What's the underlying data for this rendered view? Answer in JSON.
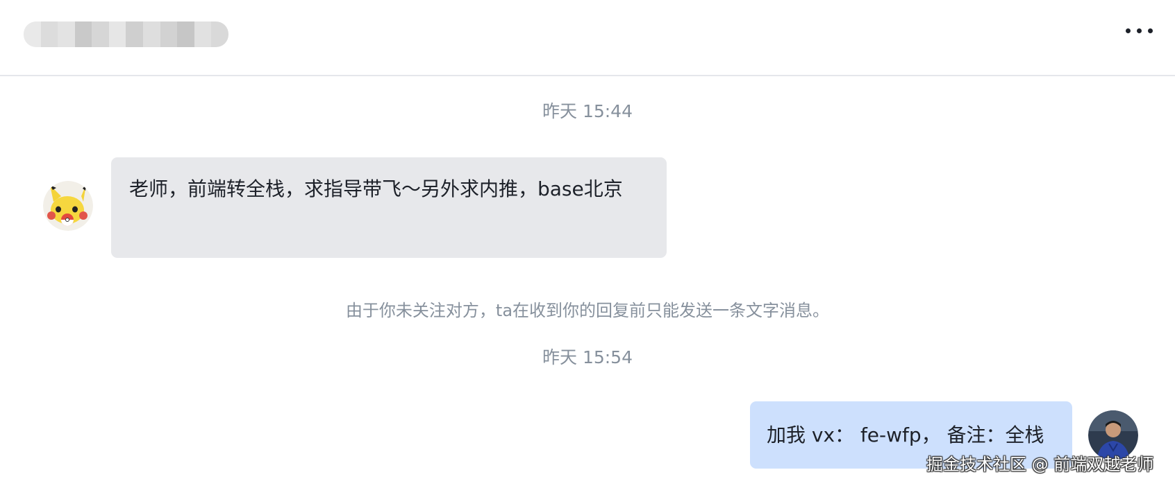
{
  "header": {
    "contact_name_blurred": "",
    "more_icon": "more-horizontal-icon"
  },
  "messages": {
    "timestamp_1": "昨天 15:44",
    "incoming_text": "老师，前端转全栈，求指导带飞～另外求内推，base北京",
    "notice": "由于你未关注对方，ta在收到你的回复前只能发送一条文字消息。",
    "timestamp_2": "昨天 15:54",
    "outgoing_text": "加我 vx： fe-wfp， 备注：全栈"
  },
  "watermark": "掘金技术社区 @ 前端双越老师",
  "colors": {
    "incoming_bubble": "#e7e8eb",
    "outgoing_bubble": "#cde0fd",
    "meta_text": "#86909c"
  }
}
